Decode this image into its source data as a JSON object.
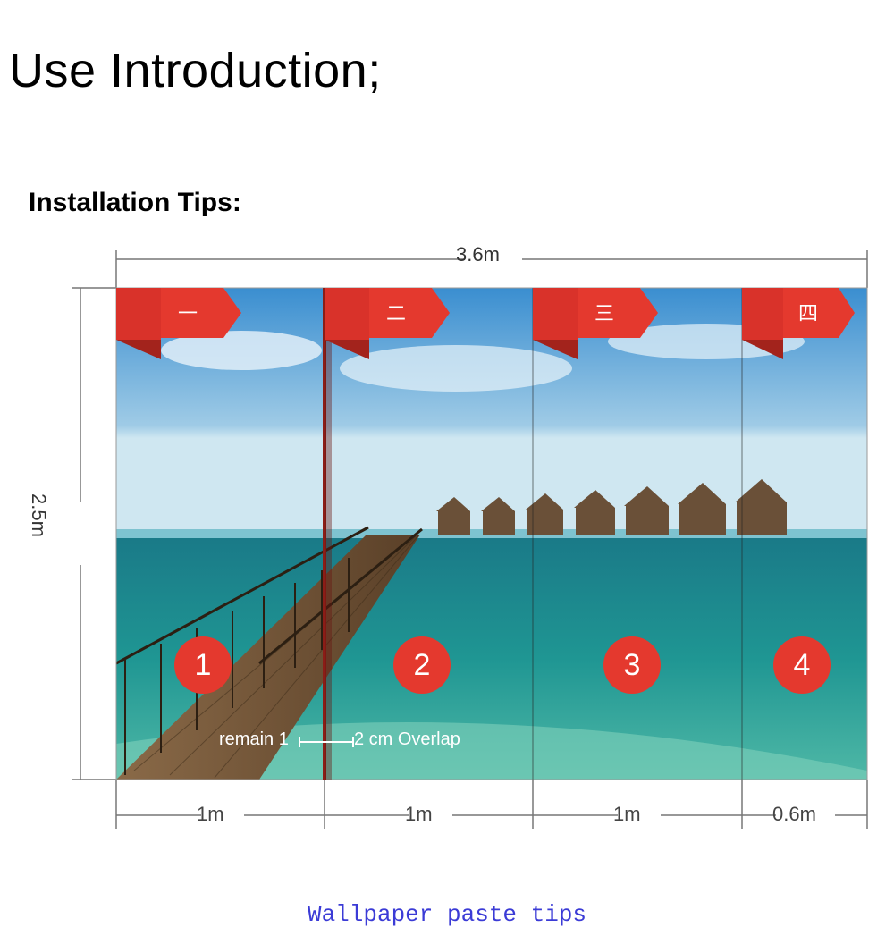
{
  "title": "Use Introduction;",
  "subtitle": "Installation Tips:",
  "dimensions": {
    "total_width": "3.6m",
    "total_height": "2.5m"
  },
  "panels": [
    {
      "number": "1",
      "width": "1m",
      "flag": "一"
    },
    {
      "number": "2",
      "width": "1m",
      "flag": "二"
    },
    {
      "number": "3",
      "width": "1m",
      "flag": "三"
    },
    {
      "number": "4",
      "width": "0.6m",
      "flag": "四"
    }
  ],
  "overlap_prefix": "remain 1",
  "overlap_suffix": " 2 cm Overlap",
  "footer": "Wallpaper paste tips"
}
